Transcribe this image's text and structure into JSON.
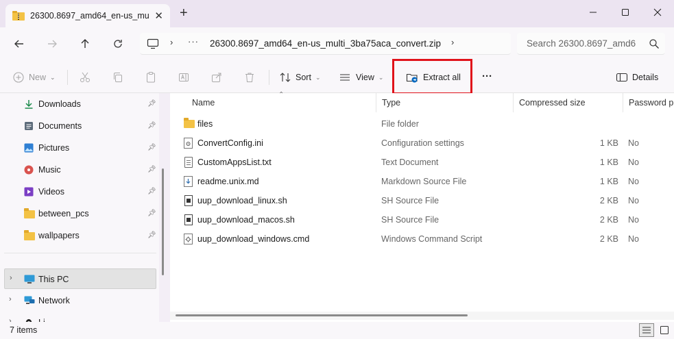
{
  "tab": {
    "title": "26300.8697_amd64_en-us_mu",
    "close": "✕",
    "new_tab": "+"
  },
  "window_controls": {
    "minimize": "—",
    "maximize": "☐",
    "close": "✕"
  },
  "address": {
    "ellipsis": "···",
    "path": "26300.8697_amd64_en-us_multi_3ba75aca_convert.zip",
    "search_placeholder": "Search 26300.8697_amd6"
  },
  "toolbar": {
    "new_label": "New",
    "sort_label": "Sort",
    "view_label": "View",
    "extract_all_label": "Extract all",
    "more_label": "···",
    "details_label": "Details"
  },
  "sidebar": {
    "quick_access": [
      {
        "label": "Downloads",
        "icon": "download-icon",
        "pinned": true
      },
      {
        "label": "Documents",
        "icon": "documents-icon",
        "pinned": true
      },
      {
        "label": "Pictures",
        "icon": "pictures-icon",
        "pinned": true
      },
      {
        "label": "Music",
        "icon": "music-icon",
        "pinned": true
      },
      {
        "label": "Videos",
        "icon": "videos-icon",
        "pinned": true
      },
      {
        "label": "between_pcs",
        "icon": "folder-icon",
        "pinned": true
      },
      {
        "label": "wallpapers",
        "icon": "folder-icon",
        "pinned": true
      }
    ],
    "this_pc": "This PC",
    "network": "Network",
    "partial_item": "Li"
  },
  "columns": {
    "name": "Name",
    "type": "Type",
    "compressed_size": "Compressed size",
    "password": "Password pre"
  },
  "files": [
    {
      "name": "files",
      "type": "File folder",
      "size": "",
      "password": "",
      "icon": "folder-icon"
    },
    {
      "name": "ConvertConfig.ini",
      "type": "Configuration settings",
      "size": "1 KB",
      "password": "No",
      "icon": "config-file-icon"
    },
    {
      "name": "CustomAppsList.txt",
      "type": "Text Document",
      "size": "1 KB",
      "password": "No",
      "icon": "text-file-icon"
    },
    {
      "name": "readme.unix.md",
      "type": "Markdown Source File",
      "size": "1 KB",
      "password": "No",
      "icon": "markdown-file-icon"
    },
    {
      "name": "uup_download_linux.sh",
      "type": "SH Source File",
      "size": "2 KB",
      "password": "No",
      "icon": "sh-file-icon"
    },
    {
      "name": "uup_download_macos.sh",
      "type": "SH Source File",
      "size": "2 KB",
      "password": "No",
      "icon": "sh-file-icon"
    },
    {
      "name": "uup_download_windows.cmd",
      "type": "Windows Command Script",
      "size": "2 KB",
      "password": "No",
      "icon": "cmd-file-icon"
    }
  ],
  "status": {
    "items_count": "7 items"
  },
  "colors": {
    "highlight": "#e0121a",
    "accent": "#0067c0",
    "folder": "#f3c245"
  }
}
